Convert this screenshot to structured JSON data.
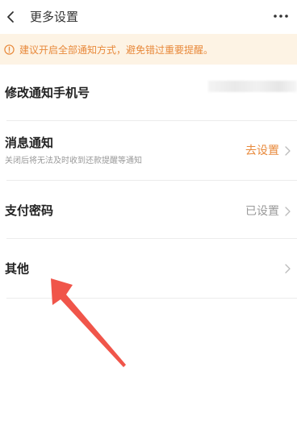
{
  "header": {
    "title": "更多设置"
  },
  "banner": {
    "text": "建议开启全部通知方式，避免错过重要提醒。"
  },
  "rows": [
    {
      "title": "修改通知手机号"
    },
    {
      "title": "消息通知",
      "subtitle": "关闭后将无法及时收到还款提醒等通知",
      "value": "去设置"
    },
    {
      "title": "支付密码",
      "value": "已设置"
    },
    {
      "title": "其他"
    }
  ],
  "colors": {
    "accent": "#e8893b",
    "banner_bg": "#fdf3e4",
    "muted": "#999999",
    "annotation_arrow": "#f0554a"
  },
  "icons": {
    "back": "chevron-left-icon",
    "more": "more-dots-icon",
    "banner": "info-circle-icon",
    "row": "chevron-right-icon"
  }
}
